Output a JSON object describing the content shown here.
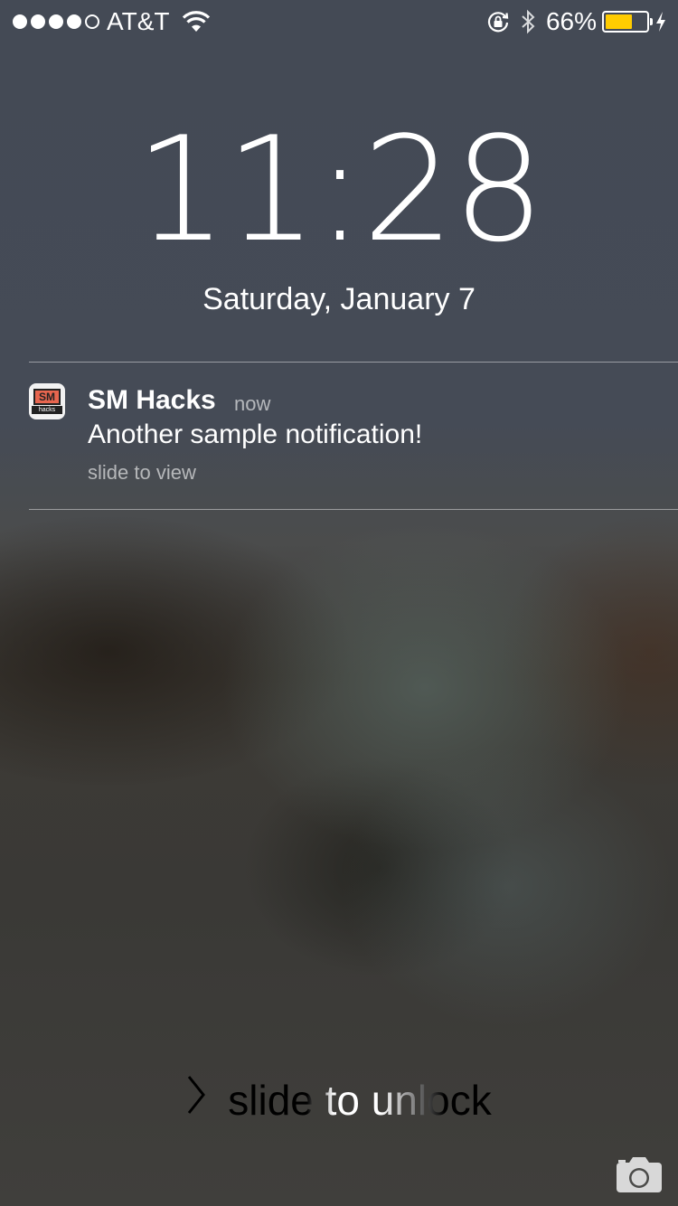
{
  "status_bar": {
    "signal_dots_filled": 4,
    "signal_dots_total": 5,
    "carrier": "AT&T",
    "battery_percent_label": "66%",
    "battery_level": 0.66,
    "battery_color": "#ffcc00",
    "icons": [
      "wifi-icon",
      "orientation-lock-icon",
      "bluetooth-icon",
      "battery-icon",
      "charging-bolt-icon"
    ]
  },
  "lock_screen": {
    "time": "11:28",
    "date": "Saturday, January 7"
  },
  "notification": {
    "app_name": "SM Hacks",
    "app_icon_text": "SM",
    "app_icon_subtext": "hacks",
    "time": "now",
    "body": "Another sample notification!",
    "action": "slide to view"
  },
  "unlock": {
    "label": "slide to unlock",
    "chevron": "chevron-right-icon"
  },
  "camera": {
    "icon": "camera-icon"
  }
}
